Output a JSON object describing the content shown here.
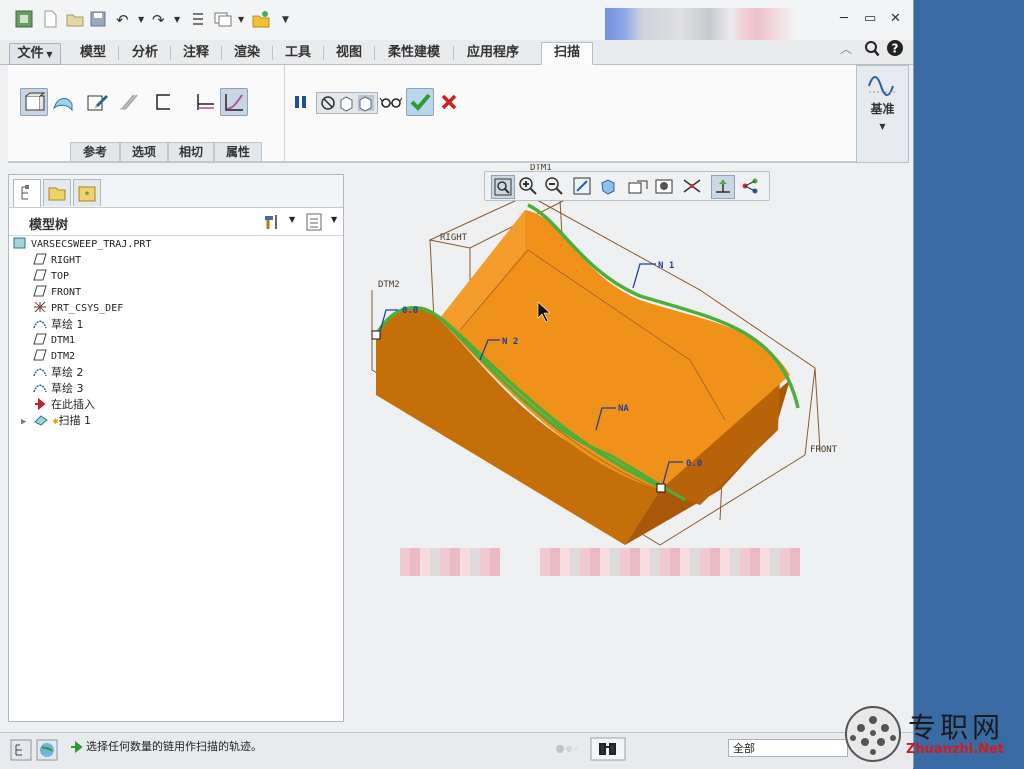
{
  "tabs": {
    "file": "文件",
    "items": [
      "模型",
      "分析",
      "注释",
      "渲染",
      "工具",
      "视图",
      "柔性建模",
      "应用程序"
    ],
    "active": "扫描"
  },
  "ribbon": {
    "subtabs": [
      "参考",
      "选项",
      "相切",
      "属性"
    ],
    "datum_label": "基准"
  },
  "model_tree": {
    "title": "模型树",
    "root": "VARSECSWEEP_TRAJ.PRT",
    "items": [
      {
        "label": "RIGHT",
        "icon": "datum-plane-icon"
      },
      {
        "label": "TOP",
        "icon": "datum-plane-icon"
      },
      {
        "label": "FRONT",
        "icon": "datum-plane-icon"
      },
      {
        "label": "PRT_CSYS_DEF",
        "icon": "csys-icon"
      },
      {
        "label": "草绘 1",
        "icon": "sketch-icon"
      },
      {
        "label": "DTM1",
        "icon": "datum-plane-icon"
      },
      {
        "label": "DTM2",
        "icon": "datum-plane-icon"
      },
      {
        "label": "草绘 2",
        "icon": "sketch-icon"
      },
      {
        "label": "草绘 3",
        "icon": "sketch-icon"
      },
      {
        "label": "在此插入",
        "icon": "insert-here-icon"
      },
      {
        "label": "扫描 1",
        "icon": "sweep-icon"
      }
    ]
  },
  "graphics": {
    "datum_labels": {
      "dtm1": "DTM1",
      "right": "RIGHT",
      "dtm2": "DTM2",
      "front": "FRONT"
    },
    "annotations": {
      "n1": "N 1",
      "n2": "N 2",
      "na": "NA",
      "v0a": "0.0",
      "v0b": "0.0"
    }
  },
  "status": {
    "message": "选择任何数量的链用作扫描的轨迹。",
    "filter": "全部"
  },
  "watermark": {
    "name": "专职网",
    "url": "Zhuanzhi.Net"
  },
  "colors": {
    "solid_top": "#f0921a",
    "solid_side": "#c56f0b",
    "trajectory": "#4caf3a",
    "datum_frame": "#8b5a2b",
    "accept": "#2e9b2e",
    "cancel": "#cc1f1f"
  }
}
